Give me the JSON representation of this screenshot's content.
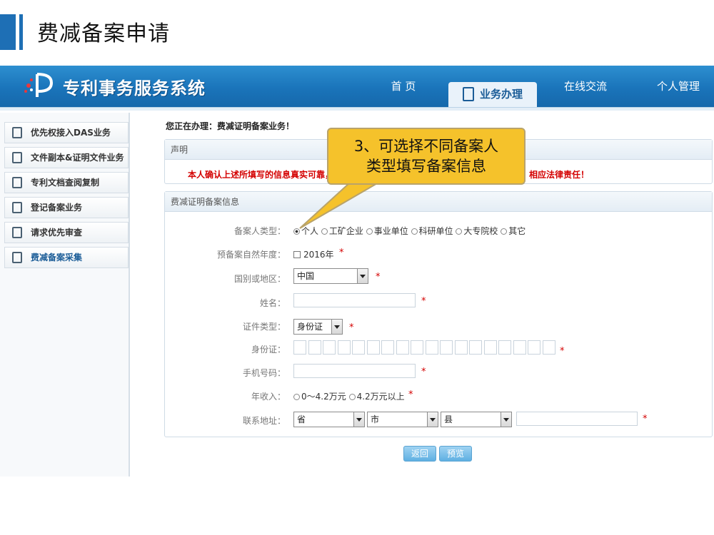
{
  "slide": {
    "title": "费减备案申请"
  },
  "header": {
    "system_name": "专利事务服务系统",
    "nav": {
      "home": "首 页",
      "business": "业务办理",
      "online": "在线交流",
      "personal": "个人管理"
    }
  },
  "sidebar": {
    "items": [
      {
        "label": "优先权接入DAS业务"
      },
      {
        "label": "文件副本&证明文件业务"
      },
      {
        "label": "专利文档查阅复制"
      },
      {
        "label": "登记备案业务"
      },
      {
        "label": "请求优先审查"
      },
      {
        "label": "费减备案采集"
      }
    ]
  },
  "main": {
    "doing": "您正在办理：费减证明备案业务！",
    "declaration": {
      "title": "声明",
      "text_left": "本人确认上述所填写的信息真实可靠，",
      "text_right": "相应法律责任！"
    },
    "form": {
      "title": "费减证明备案信息",
      "filer_type_label": "备案人类型：",
      "filer_types": [
        "个人",
        "工矿企业",
        "事业单位",
        "科研单位",
        "大专院校",
        "其它"
      ],
      "year_label": "预备案自然年度：",
      "year_value": "2016年",
      "country_label": "国别或地区：",
      "country_value": "中国",
      "name_label": "姓名：",
      "id_type_label": "证件类型：",
      "id_type_value": "身份证",
      "id_number_label": "身份证：",
      "phone_label": "手机号码：",
      "income_label": "年收入：",
      "income_options": [
        "0～4.2万元",
        "4.2万元以上"
      ],
      "address_label": "联系地址：",
      "province": "省",
      "city": "市",
      "county": "县",
      "required_mark": "*"
    },
    "buttons": {
      "back": "返回",
      "preview": "预览"
    }
  },
  "callout": {
    "line1": "3、可选择不同备案人",
    "line2": "类型填写备案信息"
  }
}
